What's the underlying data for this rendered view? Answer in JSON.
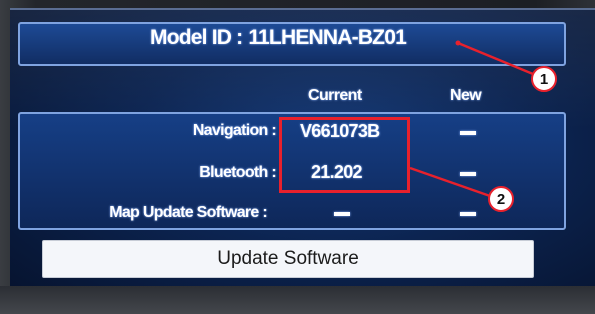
{
  "header": {
    "model_label": "Model ID :",
    "model_value": "11LHENNA-BZ01"
  },
  "table": {
    "columns": [
      "Current",
      "New"
    ],
    "rows": [
      {
        "label": "Navigation :",
        "current": "V661073B",
        "new": "–"
      },
      {
        "label": "Bluetooth :",
        "current": "21.202",
        "new": "–"
      },
      {
        "label": "Map Update Software :",
        "current": "–",
        "new": "–"
      }
    ]
  },
  "actions": {
    "update_label": "Update Software"
  },
  "callouts": {
    "one": "1",
    "two": "2"
  },
  "colors": {
    "screen_blue": "#0c2451",
    "panel_border": "#7fa3e0",
    "callout_red": "#e8212c",
    "button_bg": "#f4f6fa"
  }
}
